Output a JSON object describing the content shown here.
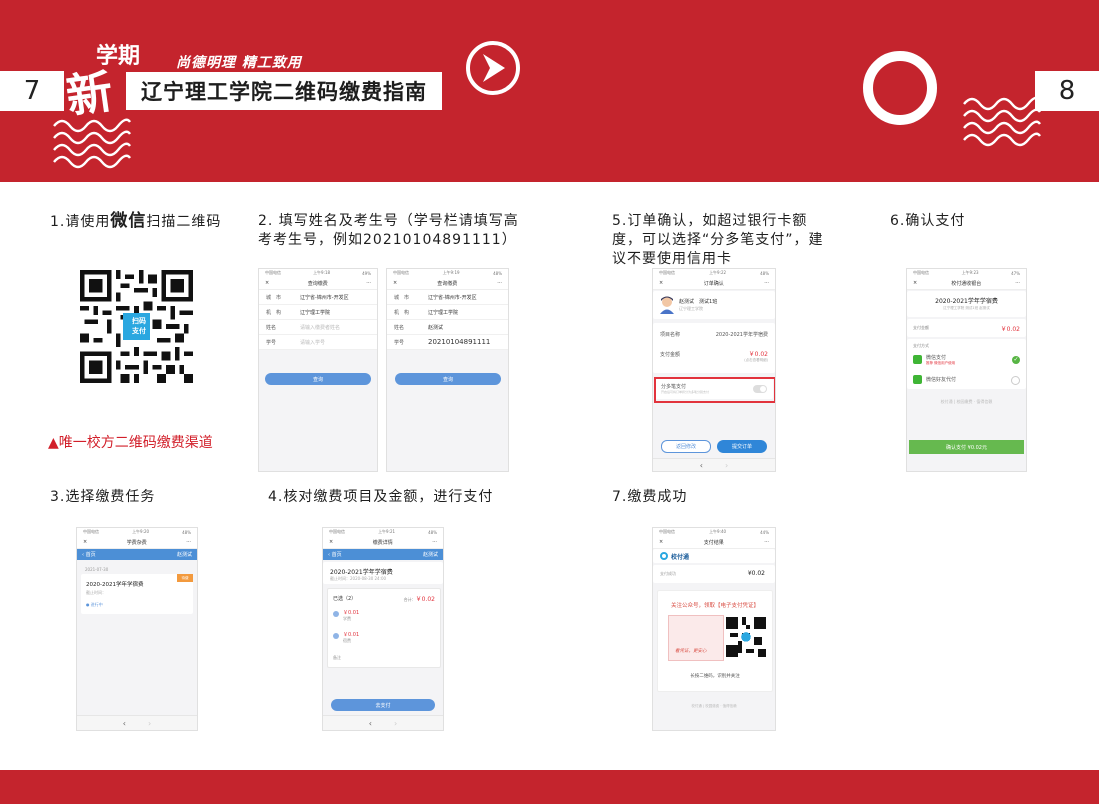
{
  "header": {
    "page_left": "7",
    "page_right": "8",
    "logo_big": "新",
    "logo_small": "学期",
    "slogan": "尚德明理 精工致用",
    "title": "辽宁理工学院二维码缴费指南"
  },
  "steps": {
    "s1_prefix": "1.请使用",
    "s1_bold": "微信",
    "s1_suffix": "扫描二维码",
    "s2": "2. 填写姓名及考生号（学号栏请填写高考考生号，例如20210104891111）",
    "s3": "3.选择缴费任务",
    "s4": "4.核对缴费项目及金额，进行支付",
    "s5": "5.订单确认，如超过银行卡额度，可以选择“分多笔支付”，建议不要使用信用卡",
    "s6": "6.确认支付",
    "s7": "7.缴费成功",
    "channel": "▲唯一校方二维码缴费渠道"
  },
  "qr_badge": {
    "line1": "扫码",
    "line2": "支付"
  },
  "status": {
    "carrier": "中国电信",
    "t1": "上午9:18",
    "t2": "上午9:19",
    "t3": "上午9:20",
    "t4": "上午9:21",
    "t5": "上午9:22",
    "t6": "上午9:23",
    "t7": "上午9:40",
    "batt1": "49%",
    "batt2": "48%",
    "batt3": "48%",
    "batt4": "48%",
    "batt5": "48%",
    "batt6": "47%",
    "batt7": "44%"
  },
  "ui": {
    "close": "×",
    "more": "···",
    "back": "‹",
    "forward": "›"
  },
  "phone_2a": {
    "nav_title": "查询缴费",
    "rows": [
      {
        "k": "城　市",
        "v": "辽宁省-锦州市-开发区"
      },
      {
        "k": "机　构",
        "v": "辽宁理工学院"
      },
      {
        "k": "姓名",
        "v": "请输入缴费者姓名"
      },
      {
        "k": "学号",
        "v": "请输入学号"
      }
    ],
    "button": "查询"
  },
  "phone_2b": {
    "nav_title": "查询缴费",
    "rows": [
      {
        "k": "城　市",
        "v": "辽宁省-锦州市-开发区"
      },
      {
        "k": "机　构",
        "v": "辽宁理工学院"
      },
      {
        "k": "姓名",
        "v": "赵测试"
      },
      {
        "k": "学号",
        "v": "20210104891111"
      }
    ],
    "button": "查询"
  },
  "phone_3": {
    "nav_title": "学费杂费",
    "home": "‹ 首页",
    "user": "赵测试",
    "date": "2021-07-30",
    "item_title": "2020-2021学年学宿费",
    "item_sub": "截止时间：",
    "badge": "待缴",
    "status": "进行中"
  },
  "phone_4": {
    "nav_title": "缴费详情",
    "home": "‹ 首页",
    "user": "赵测试",
    "item_title": "2020-2021学年学宿费",
    "deadline": "截止时间：2020-08-30 24:00",
    "selected": "已选（2）",
    "payable_label": "合计：",
    "payable": "￥0.02",
    "items": [
      {
        "amount": "￥0.01",
        "name": "学费"
      },
      {
        "amount": "￥0.01",
        "name": "宿费"
      }
    ],
    "note": "备注",
    "button": "去支付"
  },
  "phone_5": {
    "nav_title": "订单确认",
    "user_name": "赵测试",
    "user_class": "测试1班",
    "user_school": "辽宁理工学院",
    "label_item": "项目名称",
    "item_value": "2020-2021学年学宿费",
    "label_amount": "支付金额",
    "amount": "￥0.02",
    "amount_sub": "(点击查看明细)",
    "split_label": "分多笔支付",
    "split_sub": "开启后可将订单拆分为多笔分别支付",
    "btn_edit": "返回修改",
    "btn_submit": "提交订单"
  },
  "phone_6": {
    "nav_title": "校付通收银台",
    "item_title": "2020-2021学年学宿费",
    "item_sub": "辽宁理工学院 测试1班 赵测试",
    "label_amount": "支付金额",
    "amount": "￥0.02",
    "label_method": "支付方式",
    "method1": "微信支付",
    "method1_sub": "推荐 微信用户使用",
    "method2": "微信好友代付",
    "footer": "校付通 | 校园缴费 · 值得信赖",
    "button": "确认支付 ¥0.02元"
  },
  "phone_7": {
    "nav_title": "支付结果",
    "brand": "校付通",
    "label": "支付成功",
    "amount": "¥0.02",
    "promo": "关注公众号，领取【电子支付凭证】",
    "receipt_red1": "看凭证",
    "receipt_red2": "更安心",
    "scan_tip": "长按二维码，识别并关注",
    "footer": "校付通 | 校园缴费 · 值得信赖"
  },
  "colors": {
    "brand_red": "#c4242d",
    "link_blue": "#5d95db",
    "pay_green": "#66b94f",
    "warn_red": "#d21f2a"
  }
}
